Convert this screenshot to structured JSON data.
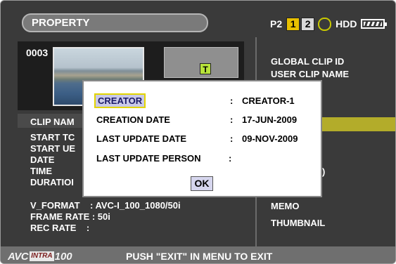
{
  "header": {
    "title": "PROPERTY",
    "media": {
      "p2_label": "P2",
      "slot1": "1",
      "slot2": "2",
      "hdd_label": "HDD"
    }
  },
  "thumbnail": {
    "clip_number": "0003",
    "badge": "T"
  },
  "clip_info": {
    "clip_name": "CLIP NAM",
    "start_tc": "START TC",
    "start_ub": "START UE",
    "date": "DATE",
    "time": "TIME",
    "duration": "DURATIOI",
    "v_format": "V_FORMAT    : AVC-I_100_1080/50i",
    "frame_rate": "FRAME RATE : 50i",
    "rec_rate": "REC RATE    :"
  },
  "menu": {
    "global_clip_id": "GLOBAL CLIP ID",
    "user_clip_name": "USER CLIP NAME",
    "partial_d": ")",
    "memo": "MEMO",
    "thumbnail": "THUMBNAIL",
    "highlight_color": "#b3ac2a"
  },
  "dialog": {
    "rows": [
      {
        "label": "CREATOR",
        "colon": ":",
        "value": "CREATOR-1"
      },
      {
        "label": "CREATION DATE",
        "colon": ":",
        "value": "17-JUN-2009"
      },
      {
        "label": "LAST UPDATE DATE",
        "colon": ":",
        "value": "09-NOV-2009"
      },
      {
        "label": "LAST UPDATE PERSON",
        "colon": ":",
        "value": ""
      }
    ],
    "ok_label": "OK"
  },
  "footer": {
    "logo_avc": "AVC",
    "logo_intra": "INTRA",
    "logo_num": "100",
    "message": "PUSH \"EXIT\" IN MENU TO EXIT"
  }
}
